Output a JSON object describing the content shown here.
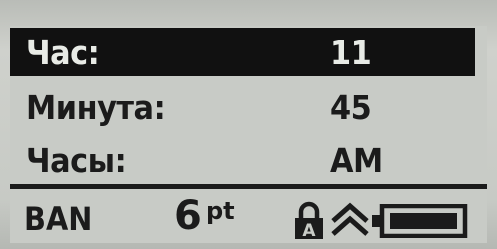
{
  "screen": {
    "rows": [
      {
        "label": "Час:",
        "value": "11",
        "selected": true
      },
      {
        "label": "Минута:",
        "value": "45",
        "selected": false
      },
      {
        "label": "Часы:",
        "value": "AM",
        "selected": false
      }
    ]
  },
  "status_bar": {
    "language": "BAN",
    "font_size": "6",
    "font_unit": "pt",
    "icons": [
      "lock-icon",
      "caps-lock-icon",
      "battery-icon"
    ],
    "battery_level": 1.0
  },
  "colors": {
    "lcd_background": "#c8cbc6",
    "lcd_text": "#1b1b1b",
    "selection_background": "#111111"
  }
}
